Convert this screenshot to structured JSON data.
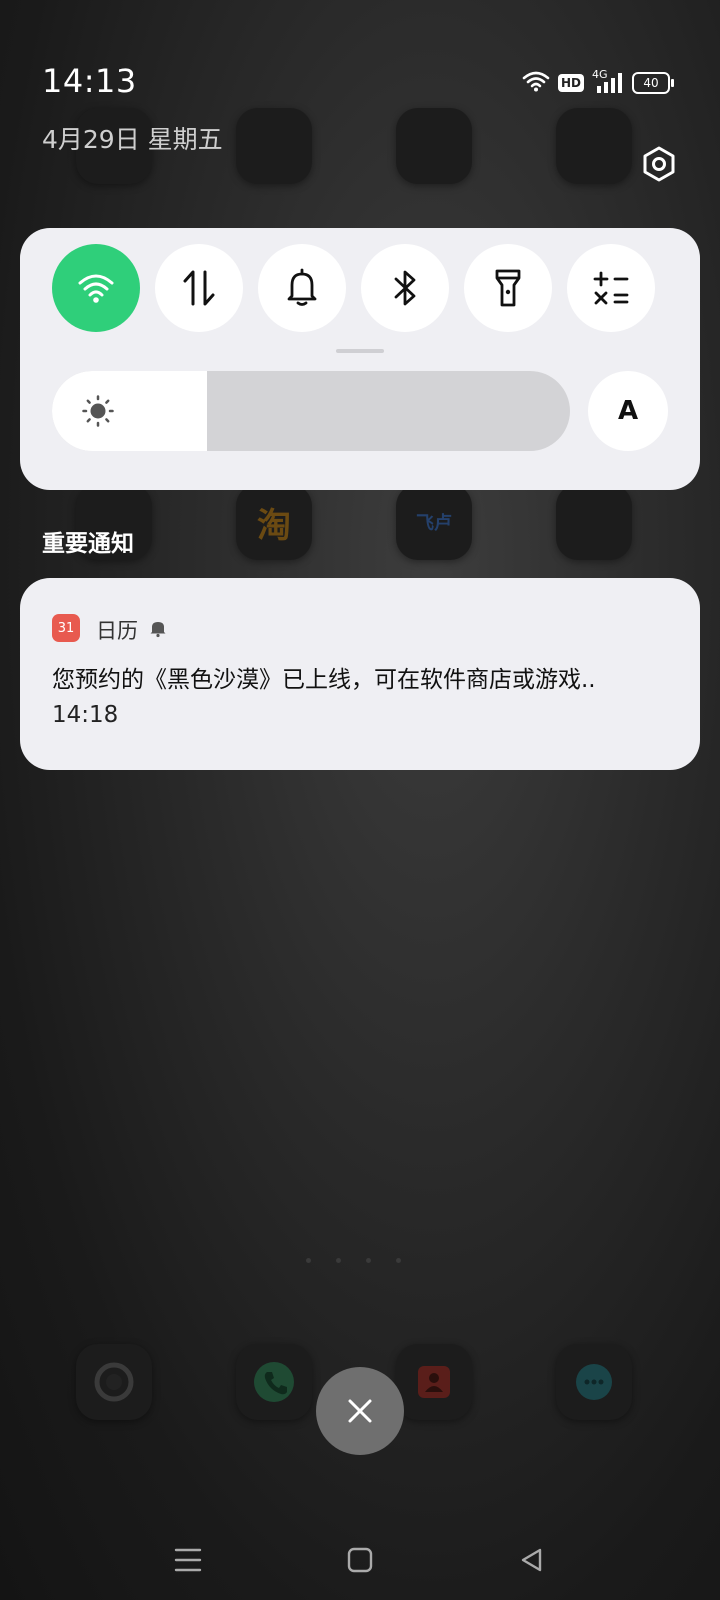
{
  "status_bar": {
    "time": "14:13",
    "date": "4月29日  星期五",
    "hd_badge": "HD",
    "network": "4G",
    "battery": "40"
  },
  "quick_settings": {
    "tiles": [
      {
        "name": "wifi",
        "icon": "wifi-icon",
        "active": true
      },
      {
        "name": "mobile-data",
        "icon": "data-transfer-icon",
        "active": false
      },
      {
        "name": "sound",
        "icon": "bell-icon",
        "active": false
      },
      {
        "name": "bluetooth",
        "icon": "bluetooth-icon",
        "active": false
      },
      {
        "name": "flashlight",
        "icon": "flashlight-icon",
        "active": false
      },
      {
        "name": "calculator",
        "icon": "calculator-icon",
        "active": false
      }
    ],
    "brightness_level": 0.3,
    "auto_brightness_label": "A"
  },
  "notifications": {
    "section_title": "重要通知",
    "items": [
      {
        "app_icon_text": "31",
        "app_name": "日历",
        "body": "您预约的《黑色沙漠》已上线，可在软件商店或游戏..",
        "time": "14:18"
      }
    ]
  },
  "background_app_glyphs": {
    "taobao": "淘",
    "feilu": "飞卢"
  },
  "colors": {
    "accent_green": "#2fcf7a",
    "panel_bg": "#efeff3",
    "calendar_red": "#e85a4f"
  }
}
